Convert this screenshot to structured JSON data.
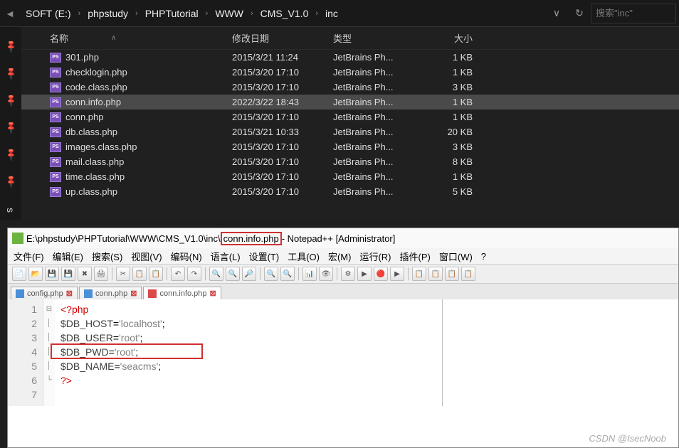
{
  "breadcrumb": {
    "items": [
      "SOFT (E:)",
      "phpstudy",
      "PHPTutorial",
      "WWW",
      "CMS_V1.0",
      "inc"
    ]
  },
  "search": {
    "placeholder": "搜索\"inc\""
  },
  "columns": {
    "name": "名称",
    "date": "修改日期",
    "type": "类型",
    "size": "大小"
  },
  "pin_label": "s",
  "files": [
    {
      "name": "301.php",
      "date": "2015/3/21 11:24",
      "type": "JetBrains Ph...",
      "size": "1 KB",
      "sel": false
    },
    {
      "name": "checklogin.php",
      "date": "2015/3/20 17:10",
      "type": "JetBrains Ph...",
      "size": "1 KB",
      "sel": false
    },
    {
      "name": "code.class.php",
      "date": "2015/3/20 17:10",
      "type": "JetBrains Ph...",
      "size": "3 KB",
      "sel": false
    },
    {
      "name": "conn.info.php",
      "date": "2022/3/22 18:43",
      "type": "JetBrains Ph...",
      "size": "1 KB",
      "sel": true
    },
    {
      "name": "conn.php",
      "date": "2015/3/20 17:10",
      "type": "JetBrains Ph...",
      "size": "1 KB",
      "sel": false
    },
    {
      "name": "db.class.php",
      "date": "2015/3/21 10:33",
      "type": "JetBrains Ph...",
      "size": "20 KB",
      "sel": false
    },
    {
      "name": "images.class.php",
      "date": "2015/3/20 17:10",
      "type": "JetBrains Ph...",
      "size": "3 KB",
      "sel": false
    },
    {
      "name": "mail.class.php",
      "date": "2015/3/20 17:10",
      "type": "JetBrains Ph...",
      "size": "8 KB",
      "sel": false
    },
    {
      "name": "time.class.php",
      "date": "2015/3/20 17:10",
      "type": "JetBrains Ph...",
      "size": "1 KB",
      "sel": false
    },
    {
      "name": "up.class.php",
      "date": "2015/3/20 17:10",
      "type": "JetBrains Ph...",
      "size": "5 KB",
      "sel": false
    }
  ],
  "npp": {
    "title_prefix": "E:\\phpstudy\\PHPTutorial\\WWW\\CMS_V1.0\\inc\\",
    "title_file": "conn.info.php",
    "title_suffix": " - Notepad++ [Administrator]",
    "menu": [
      "文件(F)",
      "编辑(E)",
      "搜索(S)",
      "视图(V)",
      "编码(N)",
      "语言(L)",
      "设置(T)",
      "工具(O)",
      "宏(M)",
      "运行(R)",
      "插件(P)",
      "窗口(W)",
      "?"
    ],
    "tabs": [
      {
        "label": "config.php",
        "active": false,
        "dirty": false
      },
      {
        "label": "conn.php",
        "active": false,
        "dirty": false
      },
      {
        "label": "conn.info.php",
        "active": true,
        "dirty": true
      }
    ],
    "code": {
      "open": "<?php",
      "l2_var": "$DB_HOST",
      "l2_val": "'localhost'",
      "l3_var": "$DB_USER",
      "l3_val": "'root'",
      "l4_var": "$DB_PWD",
      "l4_val": "'root'",
      "l5_var": "$DB_NAME",
      "l5_val": "'seacms'",
      "close": "?>"
    }
  },
  "watermark": "CSDN @IsecNoob"
}
